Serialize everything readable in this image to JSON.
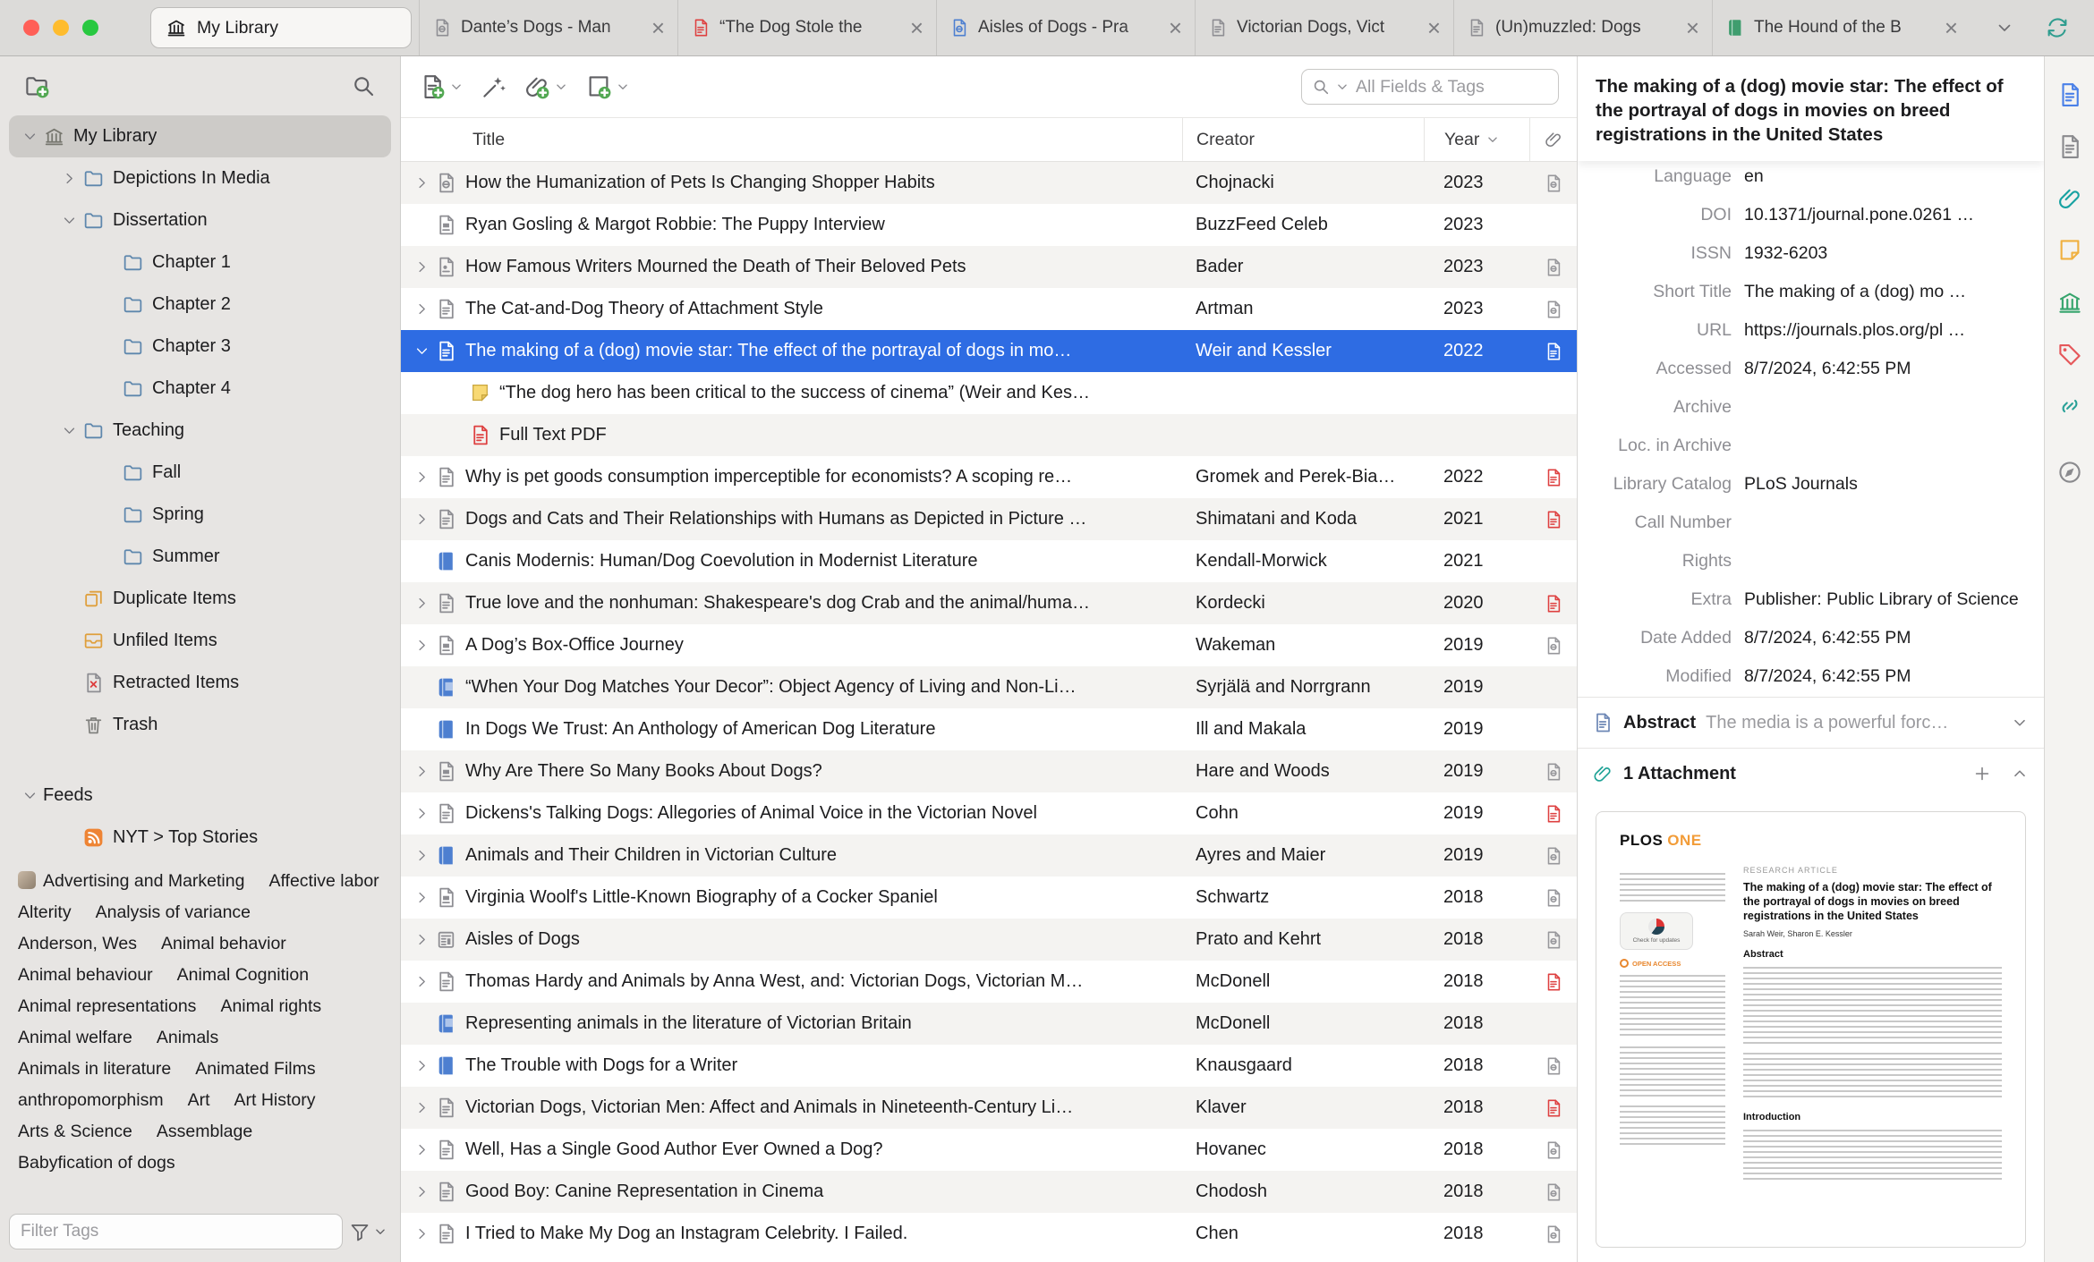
{
  "colors": {
    "accent": "#2e6ce3",
    "selection_text": "#ffffff",
    "sidebar_bg": "#e7e5e3",
    "stripe": "#f4f3f1",
    "sync_green": "#2f9d8f"
  },
  "tabbar": {
    "home_tab": {
      "label": "My Library",
      "icon": "library"
    },
    "tabs": [
      {
        "label": "Dante’s Dogs - Man",
        "icon": "webpage"
      },
      {
        "label": "“The Dog Stole the ",
        "icon": "pdf"
      },
      {
        "label": "Aisles of Dogs - Pra",
        "icon": "snapshotdoc"
      },
      {
        "label": "Victorian Dogs, Vict",
        "icon": "document"
      },
      {
        "label": "(Un)muzzled: Dogs ",
        "icon": "document"
      },
      {
        "label": "The Hound of the B",
        "icon": "epub"
      }
    ],
    "close_glyph": "×",
    "controls": [
      "tabs-menu-chevron",
      "sync"
    ]
  },
  "sidebar": {
    "toolbar_icons": [
      "new-collection",
      "search"
    ],
    "items": [
      {
        "label": "My Library",
        "icon": "library",
        "depth": 0,
        "twisty": "open",
        "selected": true
      },
      {
        "label": "Depictions In Media",
        "icon": "folder",
        "depth": 1,
        "twisty": "closed"
      },
      {
        "label": "Dissertation",
        "icon": "folder",
        "depth": 1,
        "twisty": "open"
      },
      {
        "label": "Chapter 1",
        "icon": "folder",
        "depth": 2
      },
      {
        "label": "Chapter 2",
        "icon": "folder",
        "depth": 2
      },
      {
        "label": "Chapter 3",
        "icon": "folder",
        "depth": 2
      },
      {
        "label": "Chapter 4",
        "icon": "folder",
        "depth": 2
      },
      {
        "label": "Teaching",
        "icon": "folder",
        "depth": 1,
        "twisty": "open"
      },
      {
        "label": "Fall",
        "icon": "folder",
        "depth": 2
      },
      {
        "label": "Spring",
        "icon": "folder",
        "depth": 2
      },
      {
        "label": "Summer",
        "icon": "folder",
        "depth": 2
      },
      {
        "label": "Duplicate Items",
        "icon": "duplicates",
        "depth": 1
      },
      {
        "label": "Unfiled Items",
        "icon": "unfiled",
        "depth": 1
      },
      {
        "label": "Retracted Items",
        "icon": "retracted",
        "depth": 1
      },
      {
        "label": "Trash",
        "icon": "trash",
        "depth": 1
      },
      {
        "label": "Feeds",
        "icon": null,
        "depth": 0,
        "twisty": "open",
        "gap_before": true
      },
      {
        "label": "NYT > Top Stories",
        "icon": "feed",
        "depth": 1
      }
    ],
    "tags": [
      {
        "label": "Advertising and Marketing",
        "emoji": true
      },
      {
        "label": "Affective labor"
      },
      {
        "label": "Alterity"
      },
      {
        "label": "Analysis of variance"
      },
      {
        "label": "Anderson, Wes"
      },
      {
        "label": "Animal behavior"
      },
      {
        "label": "Animal behaviour"
      },
      {
        "label": "Animal Cognition"
      },
      {
        "label": "Animal representations"
      },
      {
        "label": "Animal rights"
      },
      {
        "label": "Animal welfare"
      },
      {
        "label": "Animals"
      },
      {
        "label": "Animals in literature"
      },
      {
        "label": "Animated Films"
      },
      {
        "label": "anthropomorphism"
      },
      {
        "label": "Art"
      },
      {
        "label": "Art History"
      },
      {
        "label": "Arts & Science"
      },
      {
        "label": "Assemblage"
      },
      {
        "label": "Babyfication of dogs"
      }
    ],
    "filter_placeholder": "Filter Tags"
  },
  "items": {
    "toolbar_icons": [
      "new-item",
      "add-by-identifier-wand",
      "add-attachment",
      "new-note"
    ],
    "search_placeholder": "All Fields & Tags",
    "columns": [
      "Title",
      "Creator",
      "Year"
    ],
    "rows": [
      {
        "twisty": "closed",
        "icon": "webpage",
        "title": "How the Humanization of Pets Is Changing Shopper Habits",
        "creator": "Chojnacki",
        "year": "2023",
        "attachment": "snapshot"
      },
      {
        "icon": "magazine",
        "title": "Ryan Gosling & Margot Robbie: The Puppy Interview",
        "creator": "BuzzFeed Celeb",
        "year": "2023"
      },
      {
        "twisty": "closed",
        "icon": "blog",
        "title": "How Famous Writers Mourned the Death of Their Beloved Pets",
        "creator": "Bader",
        "year": "2023",
        "attachment": "snapshot"
      },
      {
        "twisty": "closed",
        "icon": "journal",
        "title": "The Cat-and-Dog Theory of Attachment Style",
        "creator": "Artman",
        "year": "2023",
        "attachment": "snapshot"
      },
      {
        "twisty": "open",
        "icon": "journal",
        "title": "The making of a (dog) movie star: The effect of the portrayal of dogs in mo…",
        "creator": "Weir and Kessler",
        "year": "2022",
        "attachment": "pdf",
        "selected": true
      },
      {
        "level": 2,
        "icon": "note",
        "title": "“The dog hero has been critical to the success of cinema” (Weir and Kes…"
      },
      {
        "level": 2,
        "icon": "pdf",
        "title": "Full Text PDF"
      },
      {
        "twisty": "closed",
        "icon": "journal",
        "title": "Why is pet goods consumption imperceptible for economists? A scoping re…",
        "creator": "Gromek and Perek-Bia…",
        "year": "2022",
        "attachment": "pdf"
      },
      {
        "twisty": "closed",
        "icon": "journal",
        "title": "Dogs and Cats and Their Relationships with Humans as Depicted in Picture …",
        "creator": "Shimatani and Koda",
        "year": "2021",
        "attachment": "pdf"
      },
      {
        "icon": "book",
        "title": "Canis Modernis: Human/Dog Coevolution in Modernist Literature",
        "creator": "Kendall-Morwick",
        "year": "2021"
      },
      {
        "twisty": "closed",
        "icon": "journal",
        "title": "True love and the nonhuman: Shakespeare's dog Crab and the animal/huma…",
        "creator": "Kordecki",
        "year": "2020",
        "attachment": "pdf"
      },
      {
        "twisty": "closed",
        "icon": "magazine",
        "title": "A Dog’s Box-Office Journey",
        "creator": "Wakeman",
        "year": "2019",
        "attachment": "snapshot"
      },
      {
        "icon": "booksection",
        "title": "“When Your Dog Matches Your Decor”: Object Agency of Living and Non-Li…",
        "creator": "Syrjälä and Norrgrann",
        "year": "2019"
      },
      {
        "icon": "book",
        "title": "In Dogs We Trust: An Anthology of American Dog Literature",
        "creator": "Ill and Makala",
        "year": "2019"
      },
      {
        "twisty": "closed",
        "icon": "magazine",
        "title": "Why Are There So Many Books About Dogs?",
        "creator": "Hare and Woods",
        "year": "2019",
        "attachment": "snapshot"
      },
      {
        "twisty": "closed",
        "icon": "journal",
        "title": "Dickens's Talking Dogs: Allegories of Animal Voice in the Victorian Novel",
        "creator": "Cohn",
        "year": "2019",
        "attachment": "pdf"
      },
      {
        "twisty": "closed",
        "icon": "book",
        "title": "Animals and Their Children in Victorian Culture",
        "creator": "Ayres and Maier",
        "year": "2019",
        "attachment": "snapshot"
      },
      {
        "twisty": "closed",
        "icon": "magazine",
        "title": "Virginia Woolf's Little-Known Biography of a Cocker Spaniel",
        "creator": "Schwartz",
        "year": "2018",
        "attachment": "snapshot"
      },
      {
        "twisty": "closed",
        "icon": "newspaper",
        "title": "Aisles of Dogs",
        "creator": "Prato and Kehrt",
        "year": "2018",
        "attachment": "snapshot"
      },
      {
        "twisty": "closed",
        "icon": "journal",
        "title": "Thomas Hardy and Animals by Anna West, and: Victorian Dogs, Victorian M…",
        "creator": "McDonell",
        "year": "2018",
        "attachment": "pdf"
      },
      {
        "icon": "booksection",
        "title": "Representing animals in the literature of Victorian Britain",
        "creator": "McDonell",
        "year": "2018"
      },
      {
        "twisty": "closed",
        "icon": "book",
        "title": "The Trouble with Dogs for a Writer",
        "creator": "Knausgaard",
        "year": "2018",
        "attachment": "snapshot"
      },
      {
        "twisty": "closed",
        "icon": "journal",
        "title": "Victorian Dogs, Victorian Men: Affect and Animals in Nineteenth-Century Li…",
        "creator": "Klaver",
        "year": "2018",
        "attachment": "pdf"
      },
      {
        "twisty": "closed",
        "icon": "journal",
        "title": "Well, Has a Single Good Author Ever Owned a Dog?",
        "creator": "Hovanec",
        "year": "2018",
        "attachment": "snapshot"
      },
      {
        "twisty": "closed",
        "icon": "journal",
        "title": "Good Boy: Canine Representation in Cinema",
        "creator": "Chodosh",
        "year": "2018",
        "attachment": "snapshot"
      },
      {
        "twisty": "closed",
        "icon": "journal",
        "title": "I Tried to Make My Dog an Instagram Celebrity. I Failed.",
        "creator": "Chen",
        "year": "2018",
        "attachment": "snapshot"
      }
    ]
  },
  "details": {
    "title": "The making of a (dog) movie star: The effect of the portrayal of dogs in movies on breed registrations in the United States",
    "fields": [
      {
        "label": "Language",
        "value": "en"
      },
      {
        "label": "DOI",
        "value": "10.1371/journal.pone.0261 …"
      },
      {
        "label": "ISSN",
        "value": "1932-6203"
      },
      {
        "label": "Short Title",
        "value": "The making of a (dog) mo …"
      },
      {
        "label": "URL",
        "value": "https://journals.plos.org/pl …"
      },
      {
        "label": "Accessed",
        "value": "8/7/2024, 6:42:55 PM"
      },
      {
        "label": "Archive",
        "value": ""
      },
      {
        "label": "Loc. in Archive",
        "value": ""
      },
      {
        "label": "Library Catalog",
        "value": "PLoS Journals"
      },
      {
        "label": "Call Number",
        "value": ""
      },
      {
        "label": "Rights",
        "value": ""
      },
      {
        "label": "Extra",
        "value": "Publisher: Public Library of Science"
      },
      {
        "label": "Date Added",
        "value": "8/7/2024, 6:42:55 PM"
      },
      {
        "label": "Modified",
        "value": "8/7/2024, 6:42:55 PM"
      }
    ],
    "abstract": {
      "label": "Abstract",
      "preview": "The media is a powerful forc…"
    },
    "attachments": {
      "label": "1 Attachment"
    },
    "preview": {
      "journal_black": "PLOS",
      "journal_orange": "ONE",
      "article_type": "RESEARCH ARTICLE",
      "title": "The making of a (dog) movie star: The effect of the portrayal of dogs in movies on breed registrations in the United States",
      "authors": "Sarah Weir, Sharon E. Kessler",
      "check_updates": "Check for updates",
      "open_access": "OPEN ACCESS",
      "abstract_heading": "Abstract",
      "intro_heading": "Introduction"
    },
    "pane_tabs": [
      {
        "name": "info",
        "color": "#4a80e8"
      },
      {
        "name": "abstract",
        "color": "#8a8a8e"
      },
      {
        "name": "attachments",
        "color": "#17a2a2"
      },
      {
        "name": "notes",
        "color": "#f0b03f"
      },
      {
        "name": "libraries",
        "color": "#35a46c"
      },
      {
        "name": "tags",
        "color": "#e5575a"
      },
      {
        "name": "related",
        "color": "#2aa198"
      },
      {
        "name": "locate",
        "color": "#8a8a8e"
      }
    ]
  }
}
